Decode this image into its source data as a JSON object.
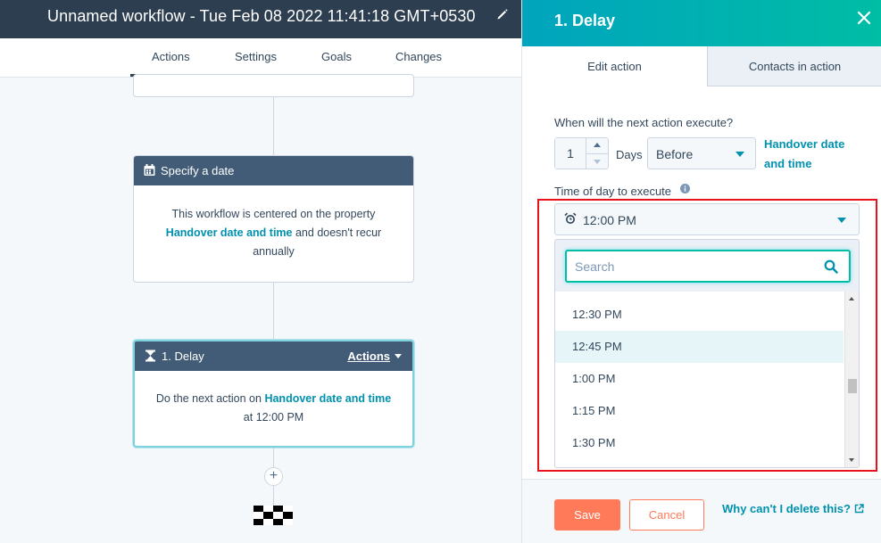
{
  "header": {
    "workflow_title": "Unnamed workflow - Tue Feb 08 2022 11:41:18 GMT+0530",
    "tabs": [
      "Actions",
      "Settings",
      "Goals",
      "Changes"
    ],
    "active_tab": "Actions"
  },
  "canvas": {
    "specify_date_card": {
      "title": "Specify a date",
      "text_before": "This workflow is centered on the property",
      "property_link": "Handover date and time",
      "text_after": "and doesn't recur",
      "text_last": "annually"
    },
    "delay_card": {
      "title": "1. Delay",
      "actions_label": "Actions",
      "text_before": "Do the next action on",
      "property_link": "Handover date and time",
      "text_at": "at",
      "time": "12:00 PM"
    },
    "add_button_label": "+"
  },
  "panel": {
    "title": "1. Delay",
    "tabs": [
      "Edit action",
      "Contacts in action"
    ],
    "active_tab": "Edit action",
    "next_action_label": "When will the next action execute?",
    "amount_value": "1",
    "unit_label": "Days",
    "relation_value": "Before",
    "property_link_line1": "Handover date",
    "property_link_line2": "and time",
    "time_of_day_label": "Time of day to execute",
    "time_value": "12:00 PM",
    "search_placeholder": "Search",
    "time_options": [
      "12:30 PM",
      "12:45 PM",
      "1:00 PM",
      "1:15 PM",
      "1:30 PM"
    ],
    "hovered_option": "12:45 PM",
    "save_label": "Save",
    "cancel_label": "Cancel",
    "why_link": "Why can't I delete this?"
  },
  "colors": {
    "header_dark": "#2d3e50",
    "card_header": "#425b76",
    "panel_gradient_start": "#00a4bd",
    "panel_gradient_end": "#00bda5",
    "link": "#0091ae",
    "primary_button": "#ff7a59",
    "highlight_border": "#e8121d"
  }
}
